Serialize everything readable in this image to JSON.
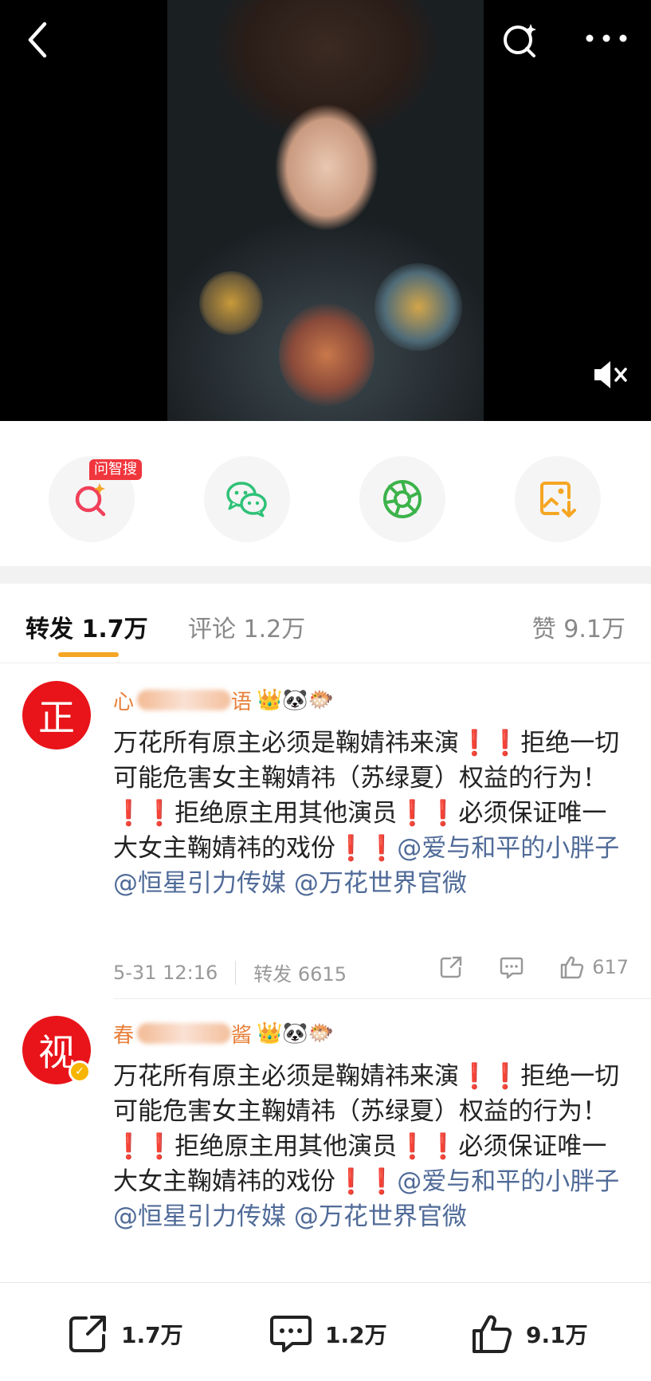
{
  "share": {
    "wenzhisou_badge": "问智搜"
  },
  "tabs": {
    "repost": "转发 1.7万",
    "comment": "评论 1.2万",
    "like": "赞 9.1万"
  },
  "reposts": [
    {
      "avatar_char": "正",
      "name_prefix": "心",
      "name_suffix": "语",
      "emojis": "👑🐼🐡",
      "text_a": "万花所有原主必须是鞠婧祎来演",
      "text_b": "拒绝一切可能危害女主鞠婧祎（苏绿夏）权益的行为！",
      "text_c": "拒绝原主用其他演员",
      "text_d": "必须保证唯一大女主鞠婧祎的戏份",
      "mark": "❗❗",
      "mention1": "@爱与和平的小胖子",
      "mention2": "@恒星引力传媒",
      "mention3": "@万花世界官微",
      "time": "5-31 12:16",
      "repost_count": "转发 6615",
      "like_count": "617"
    },
    {
      "avatar_char": "视",
      "name_prefix": "春",
      "name_suffix": "酱",
      "emojis": "👑🐼🐡",
      "text_a": "万花所有原主必须是鞠婧祎来演",
      "text_b": "拒绝一切可能危害女主鞠婧祎（苏绿夏）权益的行为！",
      "text_c": "拒绝原主用其他演员",
      "text_d": "必须保证唯一大女主鞠婧祎的戏份",
      "mark": "❗❗",
      "mention1": "@爱与和平的小胖子",
      "mention2": "@恒星引力传媒",
      "mention3": "@万花世界官微"
    }
  ],
  "bottom_bar": {
    "repost": "1.7万",
    "comment": "1.2万",
    "like": "9.1万"
  },
  "colors": {
    "accent_orange": "#f5a623",
    "mention_blue": "#506b98",
    "avatar_red": "#e8141a",
    "wechat_green": "#2ec277",
    "moments_green": "#3cb34a",
    "save_orange": "#f5a623"
  }
}
